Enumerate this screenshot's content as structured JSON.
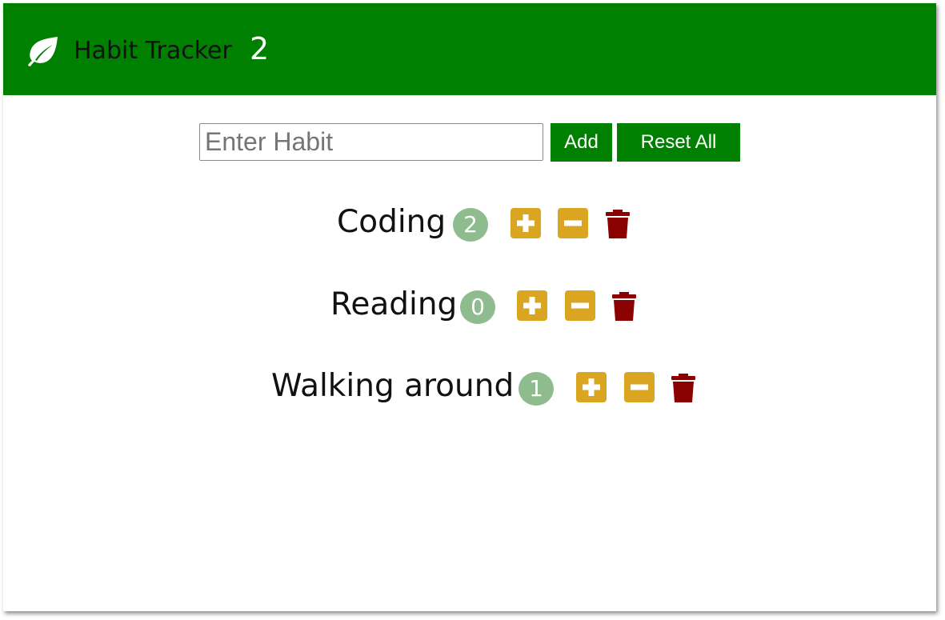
{
  "app": {
    "title": "Habit Tracker",
    "total_count": "2"
  },
  "form": {
    "input_placeholder": "Enter Habit",
    "input_value": "",
    "add_label": "Add",
    "reset_label": "Reset All"
  },
  "habits": [
    {
      "name": "Coding",
      "count": "2"
    },
    {
      "name": "Reading",
      "count": "0"
    },
    {
      "name": "Walking around",
      "count": "1"
    }
  ],
  "icons": {
    "brand": "leaf-icon",
    "increment": "plus-square-icon",
    "decrement": "minus-square-icon",
    "delete": "trash-icon"
  },
  "colors": {
    "primary": "#008000",
    "badge": "#8fbc8f",
    "action": "#daa520",
    "delete": "#8b0000",
    "brand_text": "#111111",
    "brand_count": "#ffffff"
  }
}
